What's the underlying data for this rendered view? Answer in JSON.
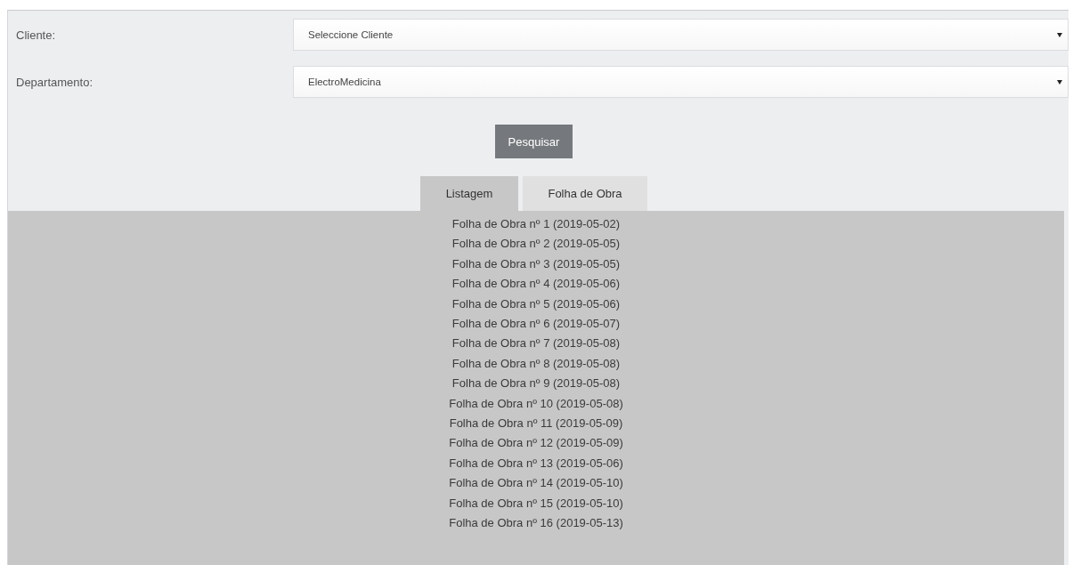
{
  "filters": [
    {
      "label": "Cliente:",
      "value": "Seleccione Cliente"
    },
    {
      "label": "Departamento:",
      "value": "ElectroMedicina"
    }
  ],
  "search_button": "Pesquisar",
  "tabs": [
    {
      "label": "Listagem",
      "selected": true
    },
    {
      "label": "Folha de Obra",
      "selected": false
    }
  ],
  "worksheets": [
    "Folha de Obra nº 1 (2019-05-02)",
    "Folha de Obra nº 2 (2019-05-05)",
    "Folha de Obra nº 3 (2019-05-05)",
    "Folha de Obra nº 4 (2019-05-06)",
    "Folha de Obra nº 5 (2019-05-06)",
    "Folha de Obra nº 6 (2019-05-07)",
    "Folha de Obra nº 7 (2019-05-08)",
    "Folha de Obra nº 8 (2019-05-08)",
    "Folha de Obra nº 9 (2019-05-08)",
    "Folha de Obra nº 10 (2019-05-08)",
    "Folha de Obra nº 11 (2019-05-09)",
    "Folha de Obra nº 12 (2019-05-09)",
    "Folha de Obra nº 13 (2019-05-06)",
    "Folha de Obra nº 14 (2019-05-10)",
    "Folha de Obra nº 15 (2019-05-10)",
    "Folha de Obra nº 16 (2019-05-13)"
  ]
}
